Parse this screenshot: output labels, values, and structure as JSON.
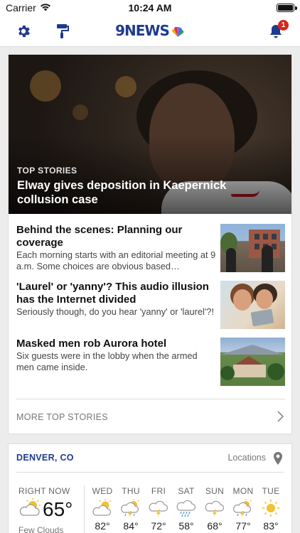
{
  "status_bar": {
    "carrier": "Carrier",
    "time": "10:24 AM"
  },
  "header": {
    "logo": "9NEWS",
    "notification_count": "1"
  },
  "hero": {
    "tag": "TOP STORIES",
    "title": "Elway gives deposition in Kaepernick collusion case"
  },
  "stories": [
    {
      "title": "Behind the scenes: Planning our coverage",
      "summary": "Each morning starts with an editorial meeting at 9 a.m. Some choices are obvious based…"
    },
    {
      "title": "'Laurel' or 'yanny'? This audio illusion has the Internet divided",
      "summary": "Seriously though, do you hear 'yanny' or 'laurel'?!"
    },
    {
      "title": "Masked men rob Aurora hotel",
      "summary": "Six guests were in the lobby when the armed men came inside."
    }
  ],
  "more_top_stories": "MORE TOP STORIES",
  "weather": {
    "city": "DENVER, CO",
    "locations_label": "Locations",
    "now": {
      "label": "RIGHT NOW",
      "temp": "65°",
      "condition": "Few Clouds",
      "icon": "partly-cloudy-icon"
    },
    "forecast": [
      {
        "day": "WED",
        "temp": "82°",
        "icon": "partly-cloudy-icon"
      },
      {
        "day": "THU",
        "temp": "84°",
        "icon": "thunderstorm-sun-icon"
      },
      {
        "day": "FRI",
        "temp": "72°",
        "icon": "thunderstorm-icon"
      },
      {
        "day": "SAT",
        "temp": "58°",
        "icon": "rain-storm-icon"
      },
      {
        "day": "SUN",
        "temp": "68°",
        "icon": "thunderstorm-icon"
      },
      {
        "day": "MON",
        "temp": "77°",
        "icon": "thunderstorm-sun-icon"
      },
      {
        "day": "TUE",
        "temp": "83°",
        "icon": "sun-icon"
      }
    ]
  },
  "colors": {
    "brand_blue": "#1f3a8e",
    "badge_red": "#d9261c",
    "weather_yellow": "#f2c230"
  }
}
